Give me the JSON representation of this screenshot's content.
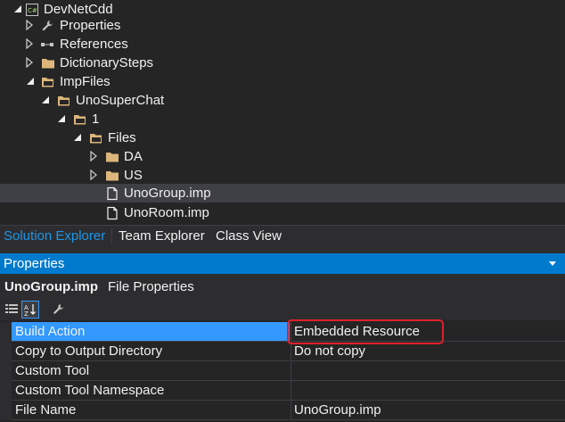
{
  "solution_tree": {
    "items": [
      {
        "label": "DevNetCdd",
        "icon": "csharp-project-icon",
        "arrow": "expanded"
      },
      {
        "label": "Properties",
        "icon": "wrench-icon",
        "arrow": "collapsed"
      },
      {
        "label": "References",
        "icon": "references-icon",
        "arrow": "collapsed"
      },
      {
        "label": "DictionarySteps",
        "icon": "folder-icon",
        "arrow": "collapsed"
      },
      {
        "label": "ImpFiles",
        "icon": "folder-open-icon",
        "arrow": "expanded"
      },
      {
        "label": "UnoSuperChat",
        "icon": "folder-open-icon",
        "arrow": "expanded"
      },
      {
        "label": "1",
        "icon": "folder-open-icon",
        "arrow": "expanded"
      },
      {
        "label": "Files",
        "icon": "folder-open-icon",
        "arrow": "expanded"
      },
      {
        "label": "DA",
        "icon": "folder-icon",
        "arrow": "collapsed"
      },
      {
        "label": "US",
        "icon": "folder-icon",
        "arrow": "collapsed"
      },
      {
        "label": "UnoGroup.imp",
        "icon": "file-icon",
        "arrow": "none"
      },
      {
        "label": "UnoRoom.imp",
        "icon": "file-icon",
        "arrow": "none"
      }
    ]
  },
  "tabs": [
    {
      "label": "Solution Explorer",
      "active": true
    },
    {
      "label": "Team Explorer",
      "active": false
    },
    {
      "label": "Class View",
      "active": false
    }
  ],
  "properties": {
    "title": "Properties",
    "object_name": "UnoGroup.imp",
    "object_type": "File Properties",
    "toolbar": [
      "categorized-icon",
      "alphabetical-icon",
      "property-pages-icon"
    ],
    "rows": [
      {
        "name": "Build Action",
        "value": "Embedded Resource"
      },
      {
        "name": "Copy to Output Directory",
        "value": "Do not copy"
      },
      {
        "name": "Custom Tool",
        "value": ""
      },
      {
        "name": "Custom Tool Namespace",
        "value": ""
      },
      {
        "name": "File Name",
        "value": "UnoGroup.imp"
      }
    ]
  },
  "colors": {
    "accent": "#007acc",
    "selected_row": "#3399ff",
    "annotation": "#e0202a"
  }
}
